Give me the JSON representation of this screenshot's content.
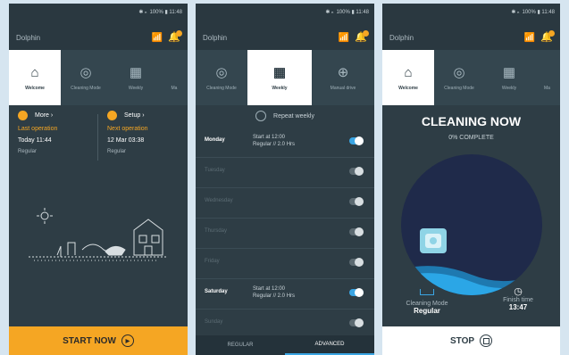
{
  "status": {
    "text": "✱ ₙ 100% ▮ 11:48"
  },
  "app_name": "Dolphin",
  "screen1": {
    "tabs": [
      {
        "icon": "home-icon",
        "label": "Welcome"
      },
      {
        "icon": "cleaning-mode-icon",
        "label": "Cleaning Mode"
      },
      {
        "icon": "calendar-icon",
        "label": "Weekly"
      },
      {
        "icon": "manual-icon",
        "label": "Ma"
      }
    ],
    "last": {
      "link": "More ›",
      "title": "Last operation",
      "time": "Today 11:44",
      "mode": "Regular"
    },
    "next": {
      "link": "Setup ›",
      "title": "Next operation",
      "time": "12 Mar 03:38",
      "mode": "Regular"
    },
    "start_button": "START NOW"
  },
  "screen2": {
    "tabs": [
      {
        "icon": "cleaning-mode-icon",
        "label": "Cleaning Mode"
      },
      {
        "icon": "calendar-icon",
        "label": "Weekly"
      },
      {
        "icon": "manual-drive-icon",
        "label": "Manual drive"
      }
    ],
    "repeat_label": "Repeat weekly",
    "days": [
      {
        "name": "Monday",
        "line1": "Start at 12:00",
        "line2": "Regular // 2.0 Hrs",
        "on": true
      },
      {
        "name": "Tuesday",
        "line1": "",
        "line2": "",
        "on": false
      },
      {
        "name": "Wednesday",
        "line1": "",
        "line2": "",
        "on": false
      },
      {
        "name": "Thursday",
        "line1": "",
        "line2": "",
        "on": false
      },
      {
        "name": "Friday",
        "line1": "",
        "line2": "",
        "on": false
      },
      {
        "name": "Saturday",
        "line1": "Start at 12:00",
        "line2": "Regular // 2.0 Hrs",
        "on": true
      },
      {
        "name": "Sunday",
        "line1": "",
        "line2": "",
        "on": false
      }
    ],
    "bottom_tabs": [
      "REGULAR",
      "ADVANCED"
    ]
  },
  "screen3": {
    "tabs": [
      {
        "icon": "home-icon",
        "label": "Welcome"
      },
      {
        "icon": "cleaning-mode-icon",
        "label": "Cleaning Mode"
      },
      {
        "icon": "calendar-icon",
        "label": "Weekly"
      },
      {
        "icon": "manual-icon",
        "label": "Ma"
      }
    ],
    "heading": "CLEANING NOW",
    "progress_text": "0% COMPLETE",
    "mode_label": "Cleaning Mode",
    "mode_value": "Regular",
    "finish_label": "Finish time",
    "finish_value": "13:47",
    "stop_button": "STOP"
  },
  "colors": {
    "accent": "#f5a623",
    "toggle_on": "#3aa5e3",
    "background": "#2e3d45",
    "cleaning_circle": "#1f2a4a"
  }
}
